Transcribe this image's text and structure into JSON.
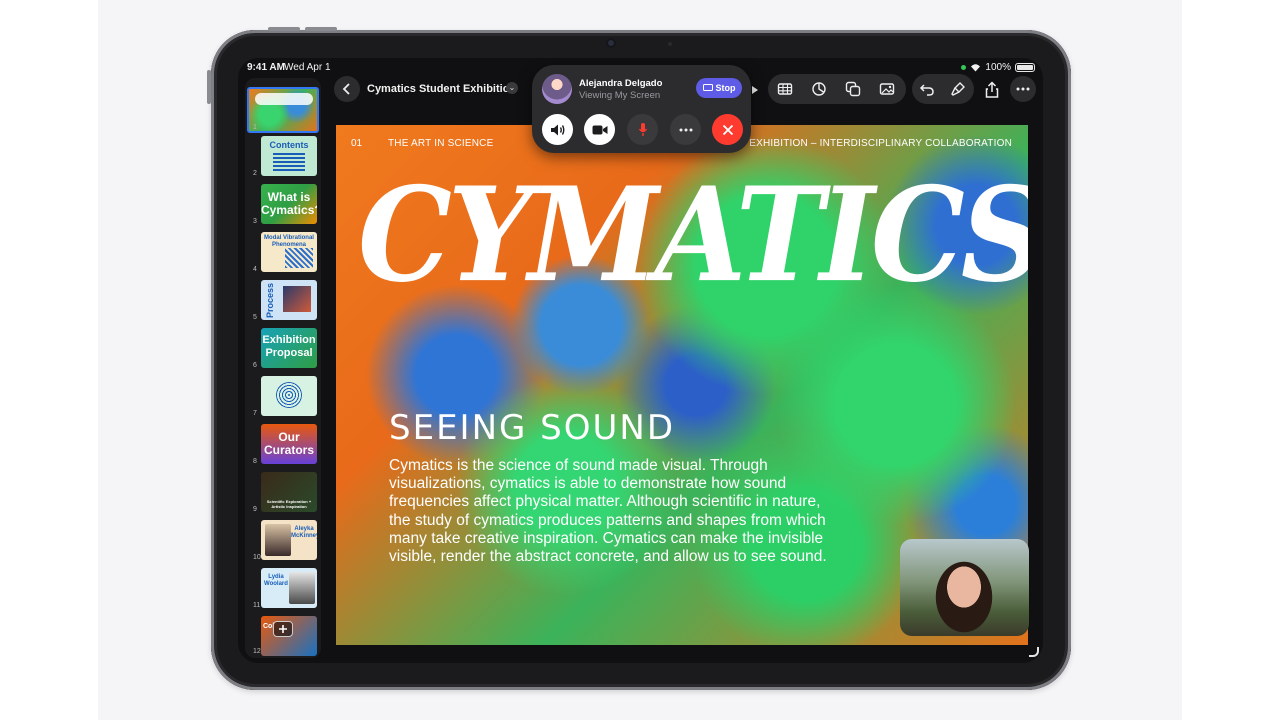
{
  "status_bar": {
    "time": "9:41 AM",
    "date": "Wed Apr 1",
    "battery": "100%"
  },
  "toolbar": {
    "doc_title": "Cymatics Student Exhibition"
  },
  "facetime": {
    "caller_name": "Alejandra Delgado",
    "status": "Viewing My Screen",
    "stop_label": "Stop"
  },
  "slides": [
    {
      "num": "1",
      "title": ""
    },
    {
      "num": "2",
      "title": "Contents"
    },
    {
      "num": "3",
      "title": "What is Cymatics?"
    },
    {
      "num": "4",
      "title": "Modal Vibrational Phenomena"
    },
    {
      "num": "5",
      "title": "Process"
    },
    {
      "num": "6",
      "title": "Exhibition Proposal"
    },
    {
      "num": "7",
      "title": ""
    },
    {
      "num": "8",
      "title": "Our Curators"
    },
    {
      "num": "9",
      "title": "Scientific Exploration + Artistic Inspiration"
    },
    {
      "num": "10",
      "title": "Aleyka McKinney"
    },
    {
      "num": "11",
      "title": "Lydia Woolard"
    },
    {
      "num": "12",
      "title": "Col"
    }
  ],
  "slide": {
    "number": "01",
    "kicker": "THE ART IN SCIENCE",
    "kicker_right": "ENT EXHIBITION – INTERDISCIPLINARY COLLABORATION",
    "title": "CYMATICS",
    "subtitle": "SEEING SOUND",
    "body": "Cymatics is the science of sound made visual. Through visualizations, cymatics is able to demonstrate how sound frequencies affect physical matter. Although scientific in nature, the study of cymatics produces patterns and shapes from which many take creative inspiration. Cymatics can make the invisible visible, render the abstract concrete, and allow us to see sound."
  },
  "colors": {
    "accent": "#3478f6",
    "stop_button": "#5e5ce6",
    "end_call": "#ff3b30"
  }
}
